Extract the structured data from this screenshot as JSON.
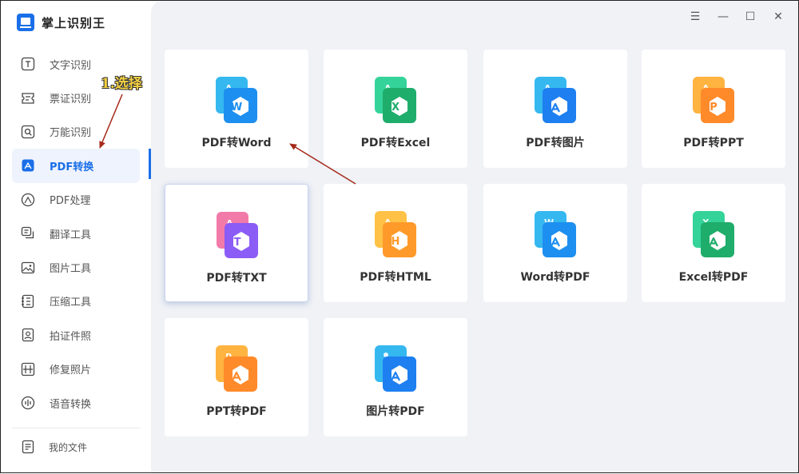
{
  "app": {
    "title": "掌上识别王"
  },
  "sidebar": {
    "items": [
      {
        "label": "文字识别",
        "icon": "text-scan-icon",
        "active": false
      },
      {
        "label": "票证识别",
        "icon": "ticket-scan-icon",
        "active": false
      },
      {
        "label": "万能识别",
        "icon": "universal-scan-icon",
        "active": false
      },
      {
        "label": "PDF转换",
        "icon": "pdf-convert-icon",
        "active": true
      },
      {
        "label": "PDF处理",
        "icon": "pdf-process-icon",
        "active": false
      },
      {
        "label": "翻译工具",
        "icon": "translate-icon",
        "active": false
      },
      {
        "label": "图片工具",
        "icon": "image-tool-icon",
        "active": false
      },
      {
        "label": "压缩工具",
        "icon": "compress-icon",
        "active": false
      },
      {
        "label": "拍证件照",
        "icon": "id-photo-icon",
        "active": false
      },
      {
        "label": "修复照片",
        "icon": "photo-repair-icon",
        "active": false
      },
      {
        "label": "语音转换",
        "icon": "voice-convert-icon",
        "active": false
      }
    ],
    "my_files": "我的文件"
  },
  "window_controls": {
    "menu": "☰",
    "minimize": "—",
    "maximize": "☐",
    "close": "✕"
  },
  "cards": [
    {
      "label": "PDF转Word",
      "letter": "W",
      "back": "#35b8f0",
      "front": "#1d8ff0",
      "src": "A"
    },
    {
      "label": "PDF转Excel",
      "letter": "X",
      "back": "#34d39a",
      "front": "#1fad6b",
      "src": "A"
    },
    {
      "label": "PDF转图片",
      "letter": "",
      "back": "#35b8f0",
      "front": "#1d7ff0",
      "src": "A"
    },
    {
      "label": "PDF转PPT",
      "letter": "P",
      "back": "#ffb340",
      "front": "#ff8a2a",
      "src": "A"
    },
    {
      "label": "PDF转TXT",
      "letter": "T",
      "back": "#f27aa8",
      "front": "#8b5cf6",
      "src": "A"
    },
    {
      "label": "PDF转HTML",
      "letter": "H",
      "back": "#ffc247",
      "front": "#ff9a2a",
      "src": "A"
    },
    {
      "label": "Word转PDF",
      "letter": "",
      "back": "#35b8f0",
      "front": "#1d8ff0",
      "src": "W"
    },
    {
      "label": "Excel转PDF",
      "letter": "",
      "back": "#34d39a",
      "front": "#1fad6b",
      "src": "X"
    },
    {
      "label": "PPT转PDF",
      "letter": "",
      "back": "#ffb340",
      "front": "#ff8a2a",
      "src": "P"
    },
    {
      "label": "图片转PDF",
      "letter": "",
      "back": "#35b8f0",
      "front": "#1d7ff0",
      "src": ""
    }
  ],
  "annotation": {
    "text": "1.选择"
  },
  "colors": {
    "accent": "#1a6fe8",
    "main_bg": "#f0f2f6",
    "arrow": "#a52a1a"
  }
}
